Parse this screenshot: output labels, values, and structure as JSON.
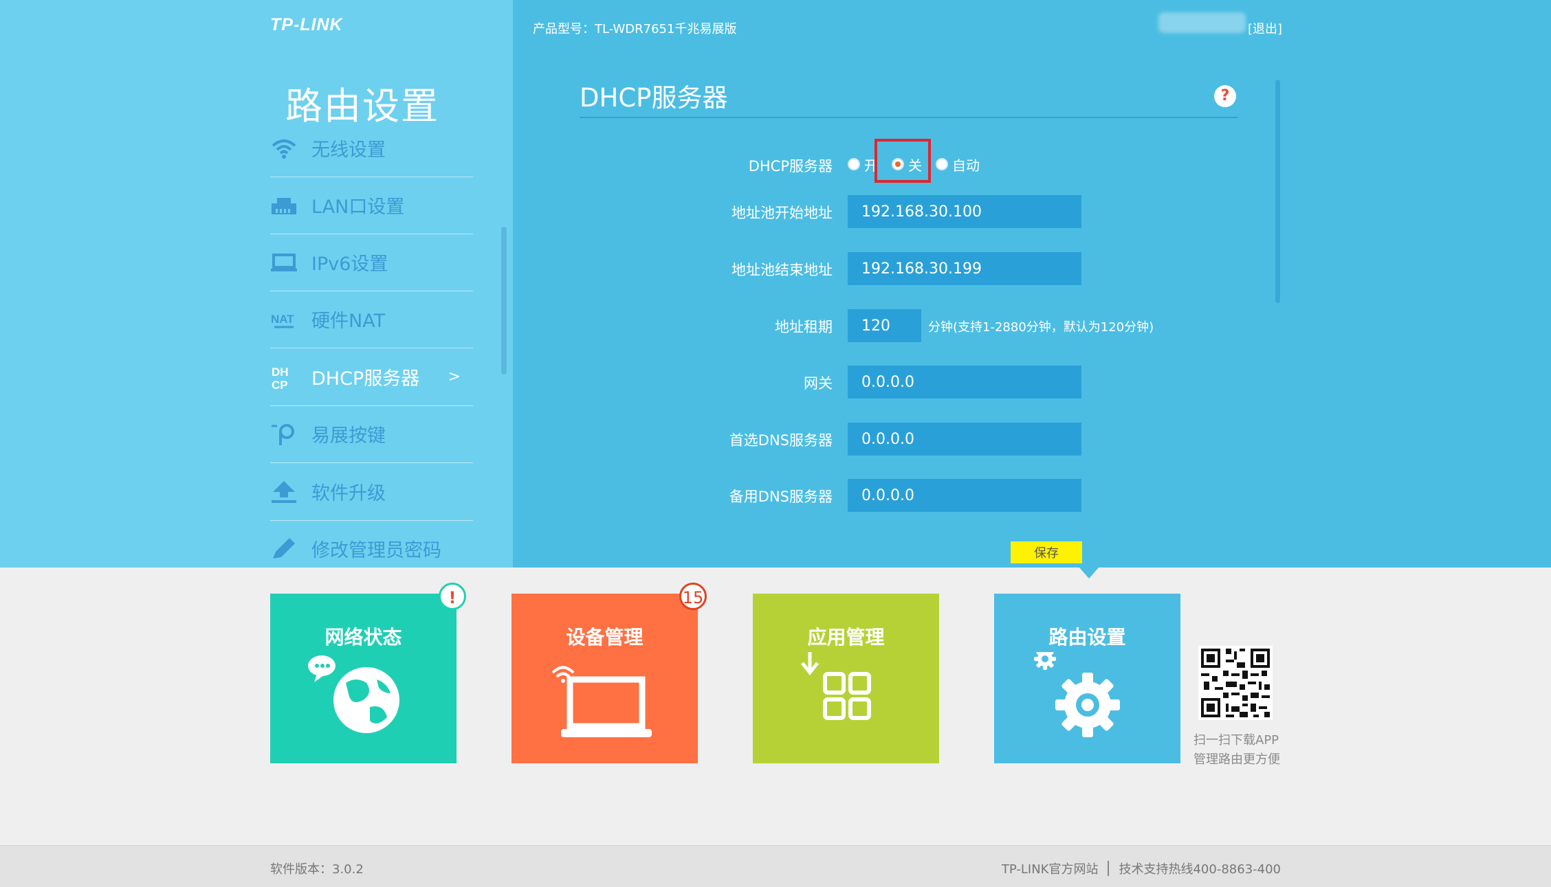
{
  "header": {
    "logo_text": "TP-LINK",
    "product_model": "产品型号：TL-WDR7651千兆易展版",
    "logout_label": "[退出]"
  },
  "sidebar": {
    "title": "路由设置",
    "items": [
      {
        "label": "无线设置",
        "icon": "wifi-icon"
      },
      {
        "label": "LAN口设置",
        "icon": "lan-port-icon"
      },
      {
        "label": "IPv6设置",
        "icon": "monitor-icon"
      },
      {
        "label": "硬件NAT",
        "icon": "nat-icon"
      },
      {
        "label": "DHCP服务器",
        "icon": "dhcp-icon",
        "active": true,
        "arrow": ">"
      },
      {
        "label": "易展按键",
        "icon": "easy-mesh-icon"
      },
      {
        "label": "软件升级",
        "icon": "upload-icon"
      },
      {
        "label": "修改管理员密码",
        "icon": "pencil-icon"
      }
    ]
  },
  "main": {
    "section_title": "DHCP服务器",
    "help_label": "?",
    "form": {
      "dhcp_label": "DHCP服务器",
      "radio_on": "开",
      "radio_off": "关",
      "radio_auto": "自动",
      "selected": "关",
      "pool_start_label": "地址池开始地址",
      "pool_start_value": "192.168.30.100",
      "pool_end_label": "地址池结束地址",
      "pool_end_value": "192.168.30.199",
      "lease_label": "地址租期",
      "lease_value": "120",
      "lease_hint": "分钟(支持1-2880分钟，默认为120分钟)",
      "gateway_label": "网关",
      "gateway_value": "0.0.0.0",
      "dns1_label": "首选DNS服务器",
      "dns1_value": "0.0.0.0",
      "dns2_label": "备用DNS服务器",
      "dns2_value": "0.0.0.0"
    },
    "save_label": "保存"
  },
  "tiles": [
    {
      "label": "网络状态",
      "color": "#1fcfb4",
      "badge": "!",
      "icon": "globe-icon"
    },
    {
      "label": "设备管理",
      "color": "#ff7043",
      "badge": "15",
      "icon": "laptop-icon"
    },
    {
      "label": "应用管理",
      "color": "#b6d136",
      "icon": "apps-icon"
    },
    {
      "label": "路由设置",
      "color": "#4bbde3",
      "icon": "gear-icon"
    }
  ],
  "qr": {
    "line1": "扫一扫下载APP",
    "line2": "管理路由更方便"
  },
  "footer": {
    "version": "软件版本：3.0.2",
    "website": "TP-LINK官方网站",
    "hotline": "技术支持热线400-8863-400"
  }
}
